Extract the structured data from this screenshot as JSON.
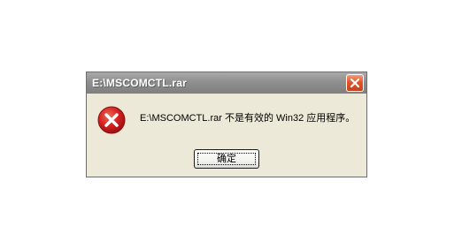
{
  "window": {
    "title": "E:\\MSCOMCTL.rar",
    "close_icon": "close-icon"
  },
  "body": {
    "icon": "error-icon",
    "message": "E:\\MSCOMCTL.rar 不是有效的 Win32 应用程序。"
  },
  "buttons": {
    "ok_label": "确定"
  },
  "colors": {
    "dialog_bg": "#ece9d8",
    "titlebar": "#8f8f8f",
    "close_button": "#e1552a",
    "error_red": "#d21f1f"
  }
}
